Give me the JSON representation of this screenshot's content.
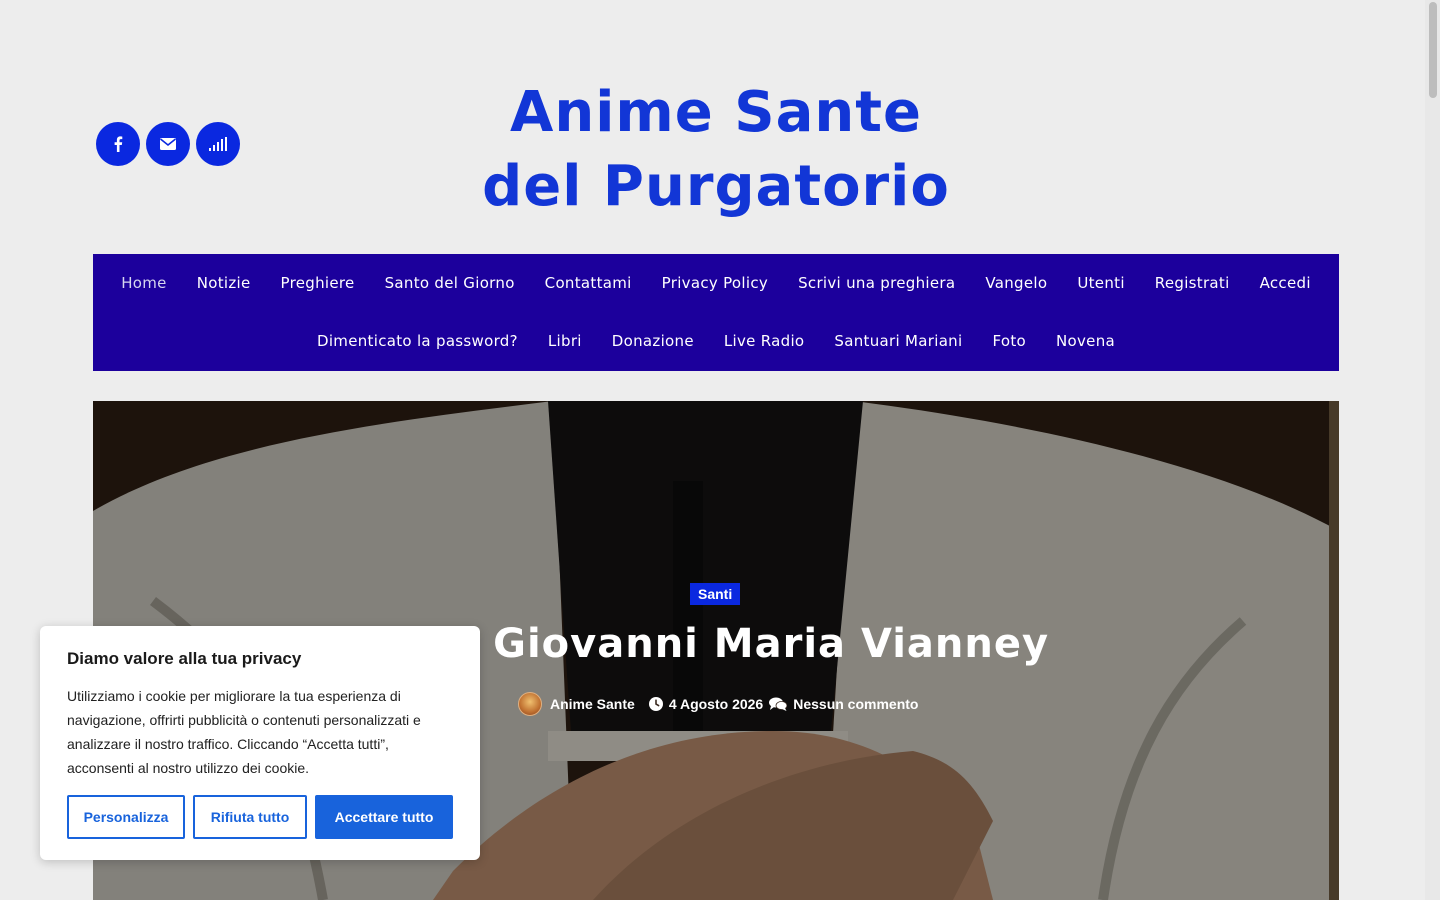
{
  "header": {
    "site_title": "Anime Sante del Purgatorio",
    "social": [
      {
        "icon": "facebook-icon"
      },
      {
        "icon": "envelope-icon"
      },
      {
        "icon": "signal-icon"
      }
    ],
    "brand_color": "#0a28e0"
  },
  "nav": {
    "row1": [
      "Home",
      "Notizie",
      "Preghiere",
      "Santo del Giorno",
      "Contattami",
      "Privacy Policy",
      "Scrivi una preghiera",
      "Vangelo",
      "Utenti",
      "Registrati",
      "Accedi"
    ],
    "row2": [
      "Dimenticato la password?",
      "Libri",
      "Donazione",
      "Live Radio",
      "Santuari Mariani",
      "Foto",
      "Novena"
    ],
    "active": "Home",
    "background": "#1c009c"
  },
  "post": {
    "category": "Santi",
    "title": "San Giovanni Maria Vianney",
    "author": "Anime Sante",
    "date": "4 Agosto 2026",
    "comments": "Nessun commento"
  },
  "cookie_banner": {
    "heading": "Diamo valore alla tua privacy",
    "text": "Utilizziamo i cookie per migliorare la tua esperienza di navigazione, offrirti pubblicità o contenuti personalizzati e analizzare il nostro traffico. Cliccando “Accetta tutti”, acconsenti al nostro utilizzo dei cookie.",
    "customize_label": "Personalizza",
    "reject_label": "Rifiuta tutto",
    "accept_label": "Accettare tutto",
    "button_color": "#1863dc"
  }
}
